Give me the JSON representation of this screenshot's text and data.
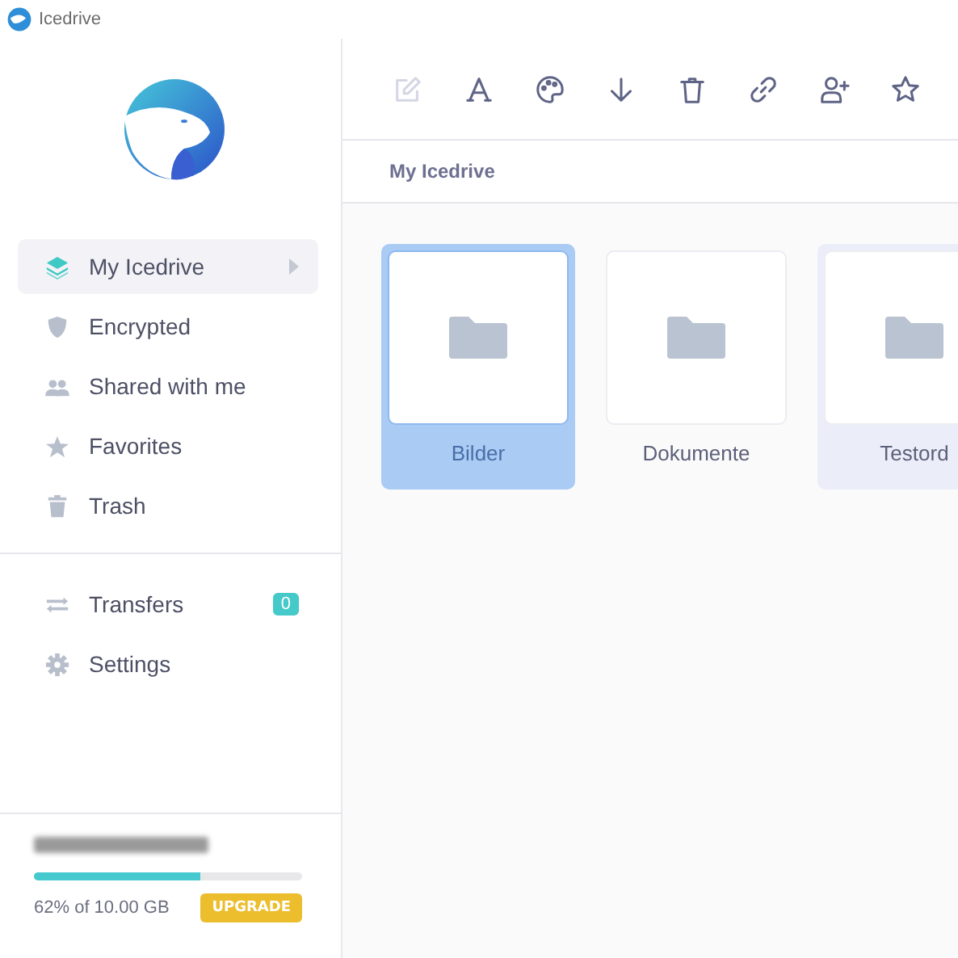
{
  "window": {
    "title": "Icedrive"
  },
  "sidebar": {
    "items": [
      {
        "label": "My Icedrive",
        "kind": "layers",
        "selected": true,
        "has_submenu": true
      },
      {
        "label": "Encrypted",
        "kind": "shield",
        "selected": false,
        "has_submenu": false
      },
      {
        "label": "Shared with me",
        "kind": "users",
        "selected": false,
        "has_submenu": false
      },
      {
        "label": "Favorites",
        "kind": "star",
        "selected": false,
        "has_submenu": false
      },
      {
        "label": "Trash",
        "kind": "trash",
        "selected": false,
        "has_submenu": false
      }
    ],
    "secondary_items": [
      {
        "label": "Transfers",
        "kind": "transfer",
        "badge": "0"
      },
      {
        "label": "Settings",
        "kind": "gear"
      }
    ]
  },
  "storage": {
    "level": 0.62,
    "usage": "62% of 10.00 GB",
    "upgrade": "UPGRADE"
  },
  "toolbar": [
    {
      "kind": "edit",
      "disabled": true
    },
    {
      "kind": "font",
      "disabled": false
    },
    {
      "kind": "palette",
      "disabled": false
    },
    {
      "kind": "download",
      "disabled": false
    },
    {
      "kind": "trash",
      "disabled": false
    },
    {
      "kind": "link",
      "disabled": false
    },
    {
      "kind": "user-plus",
      "disabled": false
    },
    {
      "kind": "star",
      "disabled": false
    }
  ],
  "breadcrumb": "My Icedrive",
  "folders": [
    {
      "name": "Bilder",
      "selected": true,
      "hovered": false
    },
    {
      "name": "Dokumente",
      "selected": false,
      "hovered": false
    },
    {
      "name": "Testord",
      "selected": false,
      "hovered": true
    }
  ]
}
